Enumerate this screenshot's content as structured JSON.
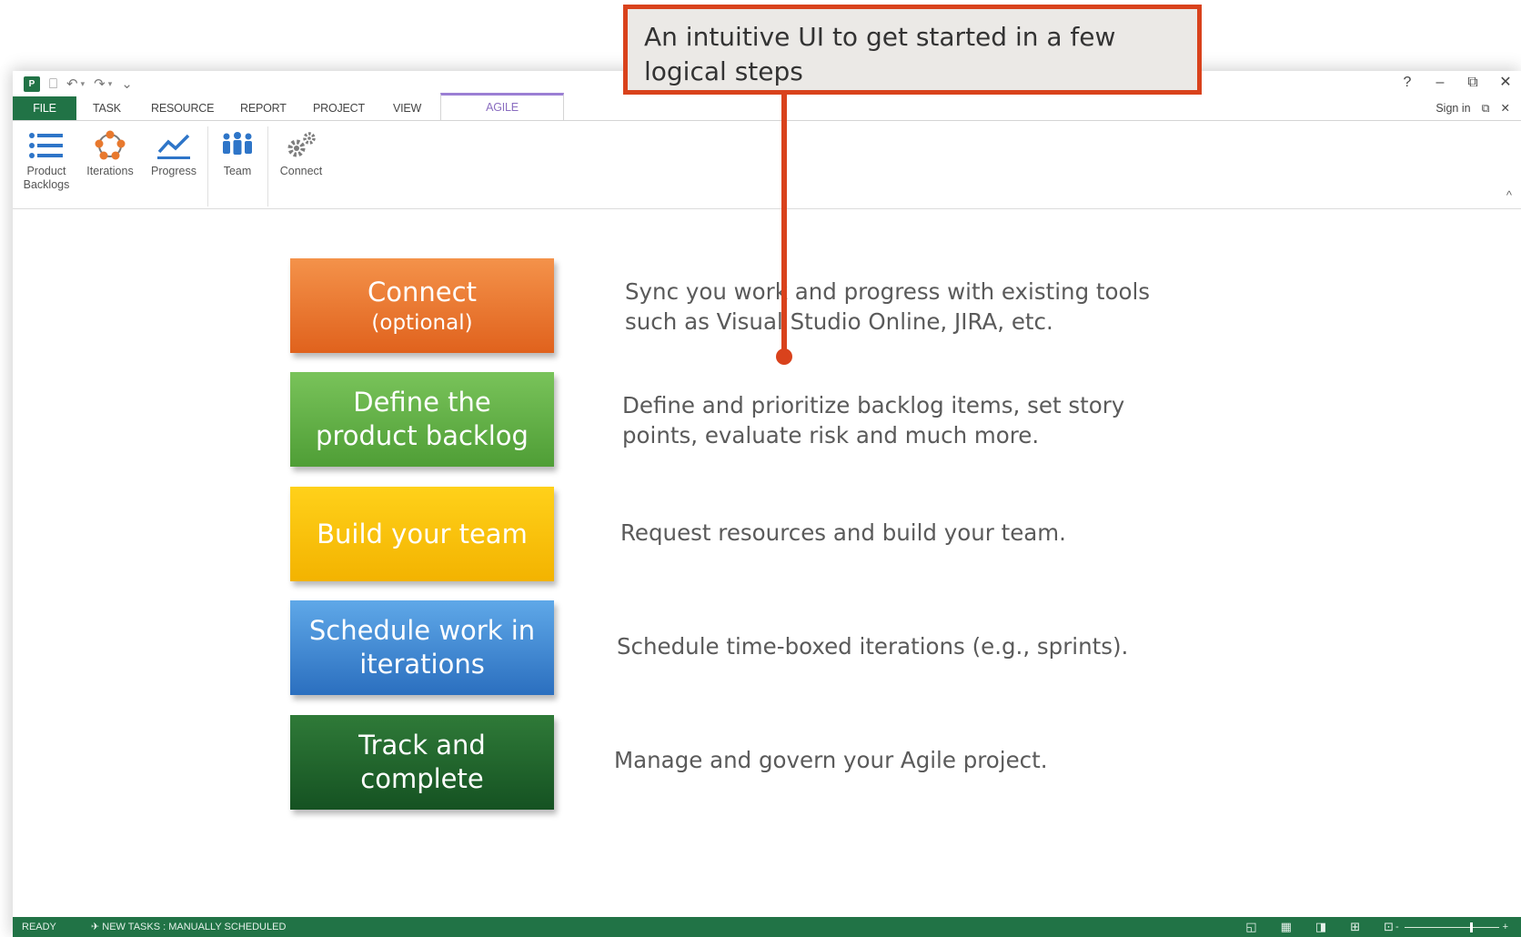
{
  "title_bar": {
    "app_icon": "P",
    "qat": [
      {
        "name": "save-icon",
        "glyph": "⎕"
      },
      {
        "name": "undo-icon",
        "glyph": "↶"
      },
      {
        "name": "redo-icon",
        "glyph": "↷"
      },
      {
        "name": "customize-qat-icon",
        "glyph": "⌄"
      }
    ],
    "window_controls": {
      "help": "?",
      "minimize": "–",
      "restore": "⧉",
      "close": "✕"
    }
  },
  "tabs": {
    "file": "FILE",
    "task": "TASK",
    "resource": "RESOURCE",
    "report": "REPORT",
    "project": "PROJECT",
    "view": "VIEW",
    "agile": "AGILE"
  },
  "account": {
    "sign_in": "Sign in",
    "restore_ribbon": "⧉",
    "close": "✕"
  },
  "ribbon": {
    "product_backlogs_line1": "Product",
    "product_backlogs_line2": "Backlogs",
    "iterations": "Iterations",
    "progress": "Progress",
    "team": "Team",
    "connect": "Connect",
    "collapse": "^"
  },
  "steps": [
    {
      "title": "Connect",
      "subtitle": "(optional)",
      "color": "#e97c33",
      "description": "Sync you work and progress with existing tools such as Visual Studio Online, JIRA, etc."
    },
    {
      "title": "Define the product backlog",
      "subtitle": "",
      "color": "#64b247",
      "description": "Define and prioritize backlog items, set story points, evaluate risk and much more."
    },
    {
      "title": "Build your team",
      "subtitle": "",
      "color": "#fbc30b",
      "description": "Request resources and build your team."
    },
    {
      "title": "Schedule work in iterations",
      "subtitle": "",
      "color": "#418ad3",
      "description": "Schedule time-boxed iterations (e.g., sprints)."
    },
    {
      "title": "Track and complete",
      "subtitle": "",
      "color": "#23652c",
      "description": "Manage and govern your Agile project."
    }
  ],
  "status_bar": {
    "ready": "READY",
    "new_tasks": "✈ NEW TASKS : MANUALLY SCHEDULED",
    "zoom_minus": "-",
    "zoom_plus": "+"
  },
  "callout": {
    "text": "An intuitive UI to get started in a few logical steps",
    "color": "#d9421c"
  }
}
